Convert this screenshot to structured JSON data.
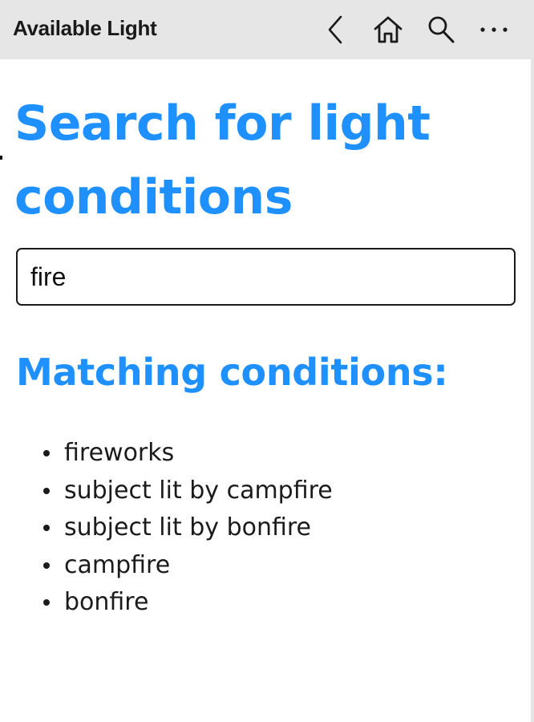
{
  "titlebar": {
    "app_title": "Available Light",
    "buttons": [
      {
        "name": "back",
        "icon": "chevron-left-icon"
      },
      {
        "name": "home",
        "icon": "home-icon"
      },
      {
        "name": "search",
        "icon": "search-icon"
      },
      {
        "name": "more",
        "icon": "more-horizontal-icon"
      }
    ]
  },
  "main": {
    "heading": "Search for light conditions",
    "search": {
      "value": "fire",
      "placeholder": ""
    },
    "results_heading": "Matching conditions:",
    "results": [
      "fireworks",
      "subject lit by campfire",
      "subject lit by bonfire",
      "campfire",
      "bonfire"
    ]
  },
  "colors": {
    "accent": "#1e90ff",
    "titlebar_bg": "#e6e6e6",
    "text": "#1b1b1b"
  }
}
